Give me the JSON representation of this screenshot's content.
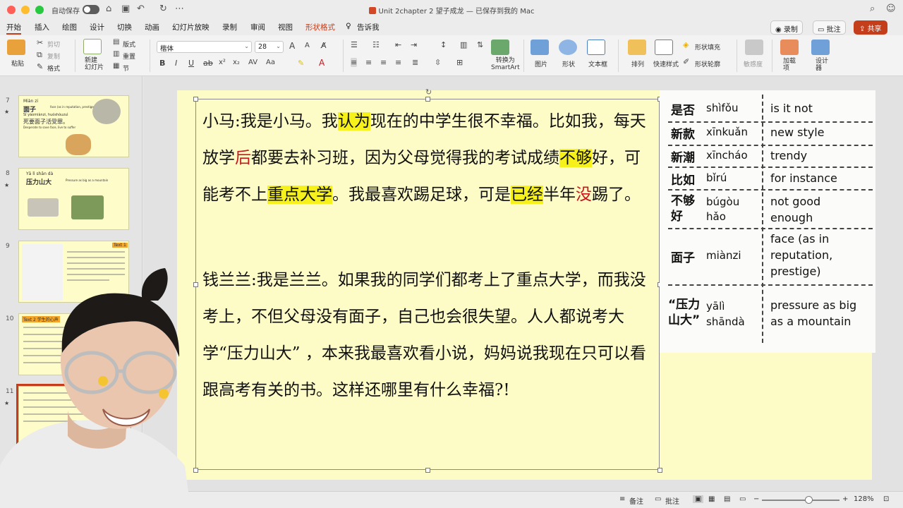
{
  "titlebar": {
    "autosave_label": "自动保存",
    "document_title": "Unit 2chapter 2 望子成龙 — 已保存到我的 Mac",
    "traffic_colors": [
      "#ff5f57",
      "#febc2e",
      "#28c840"
    ]
  },
  "menu": {
    "tabs": [
      "开始",
      "插入",
      "绘图",
      "设计",
      "切换",
      "动画",
      "幻灯片放映",
      "录制",
      "审阅",
      "视图",
      "形状格式",
      "告诉我"
    ],
    "record_button": "录制",
    "comment_button": "批注",
    "share_button": "共享"
  },
  "ribbon": {
    "paste": "粘贴",
    "cut": "剪切",
    "copy": "复制",
    "format": "格式",
    "new_slide": "新建\n幻灯片",
    "layout": "版式",
    "reset": "重置",
    "section": "节",
    "font_name": "楷体",
    "font_size": "28",
    "convert_smartart": "转换为\nSmartArt",
    "picture": "图片",
    "shape": "形状",
    "textbox": "文本框",
    "arrange": "排列",
    "quick_styles": "快速样式",
    "shape_fill": "形状填充",
    "shape_outline": "形状轮廓",
    "sensitivity": "敏感度",
    "addins": "加载\n项",
    "designer": "设计\n器"
  },
  "thumbnails": [
    {
      "number": "7",
      "title_py": "Miàn zi",
      "title": "面子",
      "desc": "face (as in reputation, prestige",
      "line2": "死要面子活受罪。",
      "line2_py": "Sǐ yàomiànzi, huóshòuzuì",
      "line3": "Desperate to save face, live to suffer"
    },
    {
      "number": "8",
      "title_py": "Yā lì shān dà",
      "title": "压力山大",
      "desc": "Pressure as big as a mountain"
    },
    {
      "number": "9",
      "badge": "Text 1"
    },
    {
      "number": "10",
      "title": "Text 2 学生的心声"
    },
    {
      "number": "11"
    }
  ],
  "slide": {
    "paragraph1": [
      {
        "t": "小马:我是小马。我"
      },
      {
        "t": "认为",
        "hl": true
      },
      {
        "t": "现在的中学生很不幸福。比如我，每天放学"
      },
      {
        "t": "后",
        "red": true
      },
      {
        "t": "都要去补习班，因为父母觉得我的考试成绩"
      },
      {
        "t": "不够",
        "hl": true
      },
      {
        "t": "好，可能考不上"
      },
      {
        "t": "重点大学",
        "hl": true
      },
      {
        "t": "。我最喜欢踢足球，可是"
      },
      {
        "t": "已经",
        "hl": true
      },
      {
        "t": "半年"
      },
      {
        "t": "没",
        "red": true
      },
      {
        "t": "踢了。"
      }
    ],
    "paragraph2": "钱兰兰:我是兰兰。如果我的同学们都考上了重点大学，而我没考上，不但父母没有面子，自己也会很失望。人人都说考大学“压力山大”  ，本来我最喜欢看小说，妈妈说我现在只可以看跟高考有关的书。这样还哪里有什么幸福?!",
    "highlight_color": "#f6f11a",
    "red_color": "#c8161d"
  },
  "vocab": [
    {
      "zh": "是否",
      "py": "shìfǒu",
      "en": "is it not"
    },
    {
      "zh": "新款",
      "py": "xīnkuǎn",
      "en": "new style"
    },
    {
      "zh": "新潮",
      "py": "xīncháo",
      "en": "trendy"
    },
    {
      "zh": "比如",
      "py": "bǐrú",
      "en": "for instance"
    },
    {
      "zh": "不够\n好",
      "py": "búgòu\nhǎo",
      "en": "not good\nenough"
    },
    {
      "zh": "面子",
      "py": "miànzi",
      "en": "face (as in\nreputation,\nprestige)"
    },
    {
      "zh": "“压力\n山大”",
      "py": "yālì\nshāndà",
      "en": "pressure as big\nas a mountain"
    }
  ],
  "statusbar": {
    "notes": "备注",
    "comments": "批注",
    "zoom": "128%"
  }
}
